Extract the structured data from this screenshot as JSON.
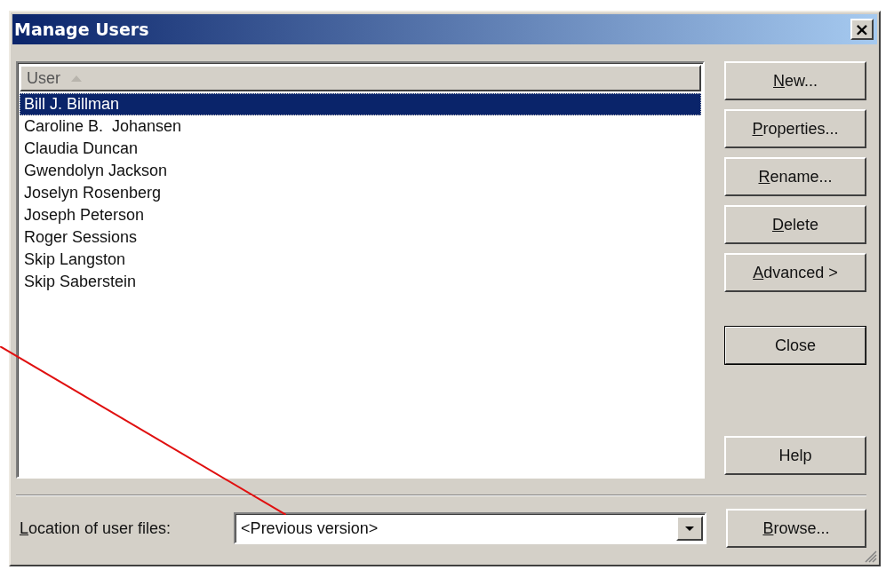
{
  "window": {
    "title": "Manage Users",
    "close_label": "×"
  },
  "user_list": {
    "column": "User",
    "rows": [
      {
        "name": "Bill J. Billman",
        "selected": true
      },
      {
        "name": "Caroline B.  Johansen",
        "selected": false
      },
      {
        "name": "Claudia Duncan",
        "selected": false
      },
      {
        "name": "Gwendolyn Jackson",
        "selected": false
      },
      {
        "name": "Joselyn Rosenberg",
        "selected": false
      },
      {
        "name": "Joseph Peterson",
        "selected": false
      },
      {
        "name": "Roger Sessions",
        "selected": false
      },
      {
        "name": "Skip Langston",
        "selected": false
      },
      {
        "name": "Skip Saberstein",
        "selected": false
      }
    ]
  },
  "buttons": [
    {
      "label": "New...",
      "mnemonic": true,
      "default": false,
      "kind": "command"
    },
    {
      "label": "Properties...",
      "mnemonic": true,
      "default": false,
      "kind": "command"
    },
    {
      "label": "Rename...",
      "mnemonic": true,
      "default": false,
      "kind": "command"
    },
    {
      "label": "Delete",
      "mnemonic": true,
      "default": false,
      "kind": "command"
    },
    {
      "label": "Advanced >",
      "mnemonic": true,
      "default": false,
      "kind": "command"
    },
    {
      "label": "Close",
      "mnemonic": false,
      "default": true,
      "kind": "dismiss"
    },
    {
      "label": "Help",
      "mnemonic": false,
      "default": false,
      "kind": "help"
    }
  ],
  "location": {
    "label": "Location of user files:",
    "mnemonic": true,
    "value": "<Previous version>"
  },
  "browse_button": {
    "label": "Browse...",
    "mnemonic": true
  }
}
